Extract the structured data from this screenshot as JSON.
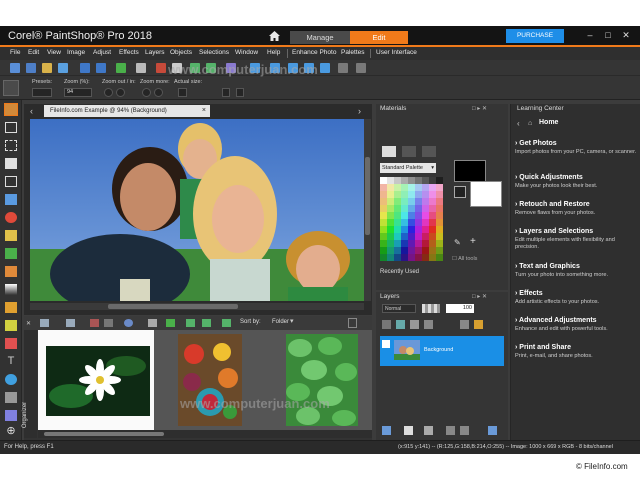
{
  "titlebar": {
    "app_title": "Corel® PaintShop® Pro 2018",
    "tabs": [
      "Manage",
      "Edit"
    ],
    "active_tab": "Edit",
    "purchase_label": "PURCHASE",
    "accent_color": "#f07a1a",
    "purchase_color": "#1e8ee8"
  },
  "menu": {
    "items": [
      "File",
      "Edit",
      "View",
      "Image",
      "Adjust",
      "Effects",
      "Layers",
      "Objects",
      "Selections",
      "Window",
      "Help",
      "Enhance Photo",
      "Palettes",
      "User Interface"
    ]
  },
  "options": {
    "presets_label": "Presets:",
    "zoom_label": "Zoom (%):",
    "zoom_value": "94",
    "zoom_out_label": "Zoom out / in:",
    "zoom_more_label": "Zoom more:",
    "actual_size_label": "Actual size:"
  },
  "document": {
    "tab_title": "FileInfo.com Example @  94% (Background)",
    "tab_close": "×"
  },
  "organizer": {
    "sort_label": "Sort by:",
    "sort_value": "Folder",
    "side_label": "Organizer"
  },
  "materials": {
    "title": "Materials",
    "palette_select": "Standard Palette",
    "all_tools_label": "All tools",
    "recently_used_label": "Recently Used"
  },
  "layers": {
    "title": "Layers",
    "blend_mode": "Normal",
    "opacity": "100",
    "layer_name": "Background"
  },
  "learning": {
    "title": "Learning Center",
    "home_label": "Home",
    "items": [
      {
        "heading": "Get Photos",
        "desc": "Import photos from your PC, camera, or scanner."
      },
      {
        "heading": "Quick Adjustments",
        "desc": "Make your photos look their best."
      },
      {
        "heading": "Retouch and Restore",
        "desc": "Remove flaws from your photos."
      },
      {
        "heading": "Layers and Selections",
        "desc": "Edit multiple elements with flexibility and precision."
      },
      {
        "heading": "Text and Graphics",
        "desc": "Turn your photo into something more."
      },
      {
        "heading": "Effects",
        "desc": "Add artistic effects to your photos."
      },
      {
        "heading": "Advanced Adjustments",
        "desc": "Enhance and edit with powerful tools."
      },
      {
        "heading": "Print and Share",
        "desc": "Print, e-mail, and share photos."
      }
    ]
  },
  "status": {
    "left": "For Help, press F1",
    "right": "(x:915 y:141) -- (R:125,G:158,B:214,O:255) -- Image:  1000 x 669 x RGB - 8 bits/channel"
  },
  "watermarks": {
    "site": "www.computerjuan.com",
    "fileinfo": "© FileInfo.com"
  }
}
